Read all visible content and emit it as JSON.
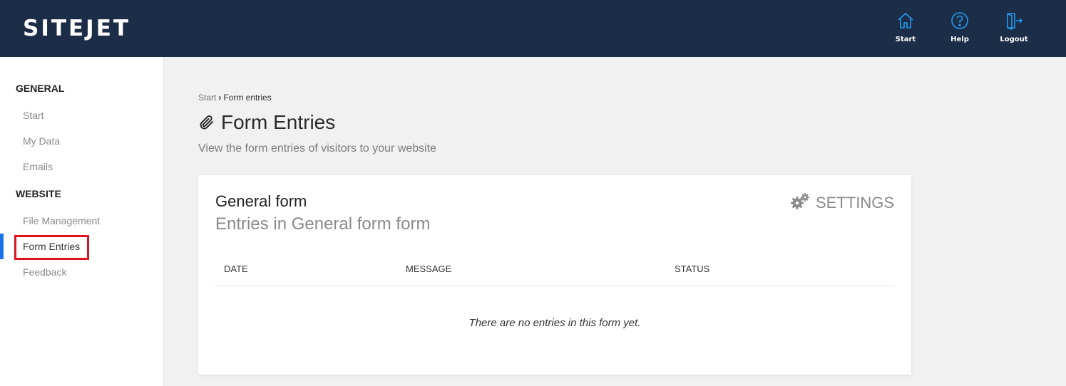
{
  "header": {
    "logo": "SITEJET",
    "nav": [
      {
        "label": "Start",
        "icon": "home-icon"
      },
      {
        "label": "Help",
        "icon": "help-icon"
      },
      {
        "label": "Logout",
        "icon": "logout-icon"
      }
    ],
    "icon_color": "#1f9cf0"
  },
  "sidebar": {
    "sections": [
      {
        "title": "GENERAL",
        "items": [
          "Start",
          "My Data",
          "Emails"
        ]
      },
      {
        "title": "WEBSITE",
        "items": [
          "File Management",
          "Form Entries",
          "Feedback"
        ]
      }
    ],
    "active_item": "Form Entries"
  },
  "main": {
    "breadcrumb": {
      "start": "Start",
      "current": "Form entries"
    },
    "title": "Form Entries",
    "subtitle": "View the form entries of visitors to your website",
    "card": {
      "title": "General form",
      "subtitle": "Entries in General form form",
      "settings_label": "SETTINGS",
      "columns": [
        "DATE",
        "MESSAGE",
        "STATUS"
      ],
      "empty_message": "There are no entries in this form yet."
    }
  }
}
